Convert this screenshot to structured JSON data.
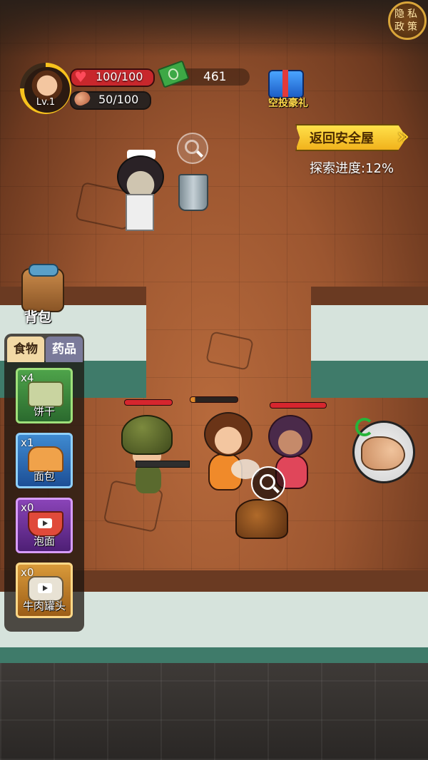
{
  "hud": {
    "level": "Lv.1",
    "hp": "100/100",
    "food": "50/100",
    "money": "461",
    "airdrop_label": "空投豪礼",
    "privacy_label": "隐私政策",
    "return_button": "返回安全屋",
    "explore_progress": "探索进度:12%"
  },
  "backpack": {
    "label": "背包"
  },
  "panel": {
    "tabs": [
      {
        "label": "食物",
        "active": true
      },
      {
        "label": "药品",
        "active": false
      }
    ],
    "items": [
      {
        "count": "x4",
        "name": "饼干",
        "icon": "biscuit-icon",
        "ad_required": false
      },
      {
        "count": "x1",
        "name": "面包",
        "icon": "bread-icon",
        "ad_required": false
      },
      {
        "count": "x0",
        "name": "泡面",
        "icon": "instant-noodle-icon",
        "ad_required": true
      },
      {
        "count": "x0",
        "name": "牛肉罐头",
        "icon": "beef-can-icon",
        "ad_required": true
      }
    ]
  },
  "colors": {
    "hp_bar": "#c8272c",
    "accent_yellow": "#f7c21d",
    "airdrop_label": "#ffd84a"
  }
}
